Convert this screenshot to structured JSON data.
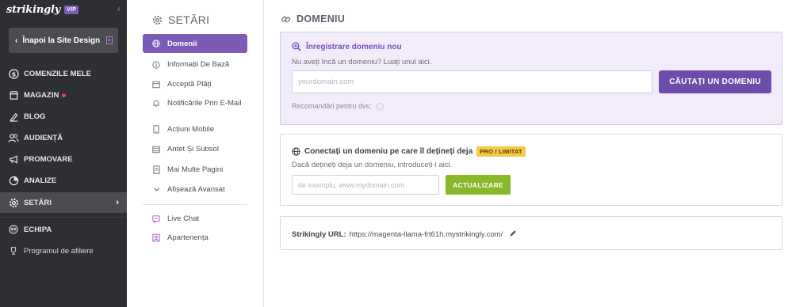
{
  "brand": {
    "logo": "strikingly",
    "badge": "VIP"
  },
  "nav": {
    "back_label": "Înapoi la Site Design",
    "items": [
      {
        "label": "COMENZILE MELE"
      },
      {
        "label": "MAGAZIN"
      },
      {
        "label": "BLOG"
      },
      {
        "label": "AUDIENȚĂ"
      },
      {
        "label": "PROMOVARE"
      },
      {
        "label": "ANALIZE"
      },
      {
        "label": "SETĂRI"
      },
      {
        "label": "ECHIPA"
      },
      {
        "label": "Programul de afiliere"
      }
    ]
  },
  "settings_menu": {
    "title": "SETĂRI",
    "items": [
      {
        "label": "Domenii"
      },
      {
        "label": "Informații De Bază"
      },
      {
        "label": "Acceptă Plăți"
      },
      {
        "label": "Notificările Prin E-Mail"
      },
      {
        "label": "Acțiuni Mobile"
      },
      {
        "label": "Antet Și Subsol"
      },
      {
        "label": "Mai Multe Pagini"
      },
      {
        "label": "Afișează Avansat"
      },
      {
        "label": "Live Chat"
      },
      {
        "label": "Apartenența"
      }
    ]
  },
  "main": {
    "title": "DOMENIU",
    "register": {
      "heading": "Înregistrare domeniu nou",
      "subtitle": "Nu aveți încă un domeniu? Luați unul aici.",
      "placeholder": "yourdomain.com",
      "button": "CĂUTAȚI UN DOMENIU",
      "recommendations": "Recomandări pentru dvs:"
    },
    "connect": {
      "heading": "Conectați un domeniu pe care îl dețineți deja",
      "badge": "PRO / LIMITAT",
      "subtitle": "Dacă dețineți deja un domeniu, introduceți-l aici.",
      "placeholder": "de exemplu, www.mydomain.com",
      "button": "ACTUALIZARE"
    },
    "url": {
      "label": "Strikingly URL:",
      "value": "https://magenta-llama-frt61h.mystrikingly.com/"
    }
  },
  "colors": {
    "nav_bg": "#2e2f33",
    "accent_purple": "#7c5bb6",
    "register_bg": "#f1ebfa",
    "update_green": "#8ab82b",
    "pro_yellow": "#f7c948"
  },
  "icons": [
    "chevron-left-icon",
    "page-icon",
    "dollar-icon",
    "store-icon",
    "pen-icon",
    "people-icon",
    "megaphone-icon",
    "chart-icon",
    "gear-icon",
    "chevron-right-icon",
    "team-icon",
    "trophy-icon",
    "globe-icon",
    "info-icon",
    "payment-icon",
    "bell-icon",
    "mobile-icon",
    "header-icon",
    "pages-icon",
    "chevron-down-icon",
    "chat-icon",
    "member-icon",
    "link-icon",
    "search-plus-icon",
    "spinner-icon",
    "pencil-icon"
  ]
}
